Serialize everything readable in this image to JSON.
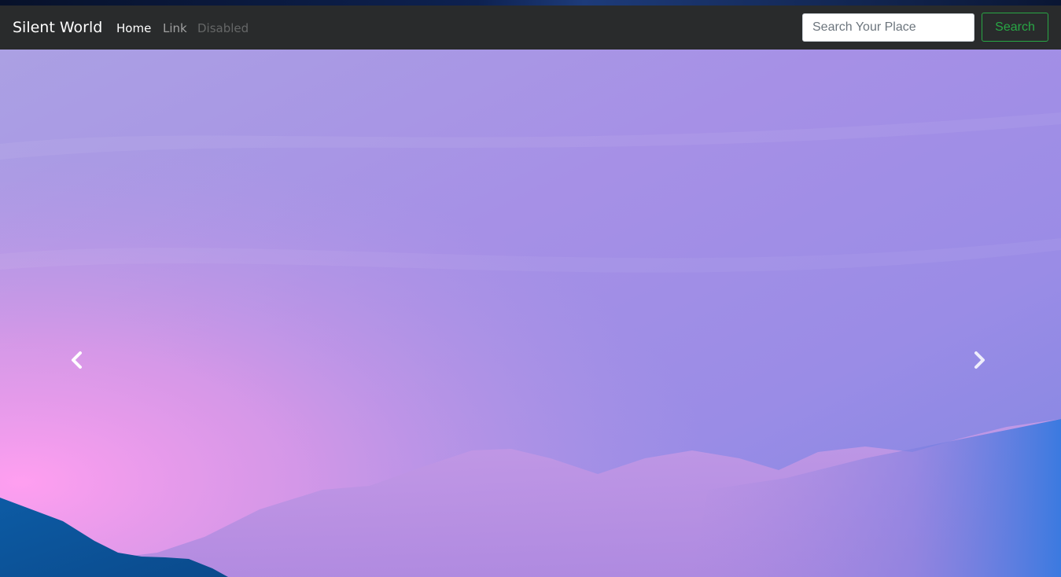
{
  "navbar": {
    "brand": "Silent World",
    "links": [
      {
        "label": "Home",
        "state": "active"
      },
      {
        "label": "Link",
        "state": "normal"
      },
      {
        "label": "Disabled",
        "state": "disabled"
      }
    ],
    "search": {
      "placeholder": "Search Your Place",
      "value": "",
      "button_label": "Search"
    }
  },
  "carousel": {
    "prev_icon": "chevron-left-icon",
    "next_icon": "chevron-right-icon",
    "slide": "pastel purple-pink sky over blue mountain silhouettes"
  },
  "colors": {
    "navbar_bg": "#292b2c",
    "search_button_accent": "#28a745",
    "sky_top": "#a99be0",
    "sky_pink": "#f99fe8",
    "mountain_blue": "#0e5aa0"
  }
}
